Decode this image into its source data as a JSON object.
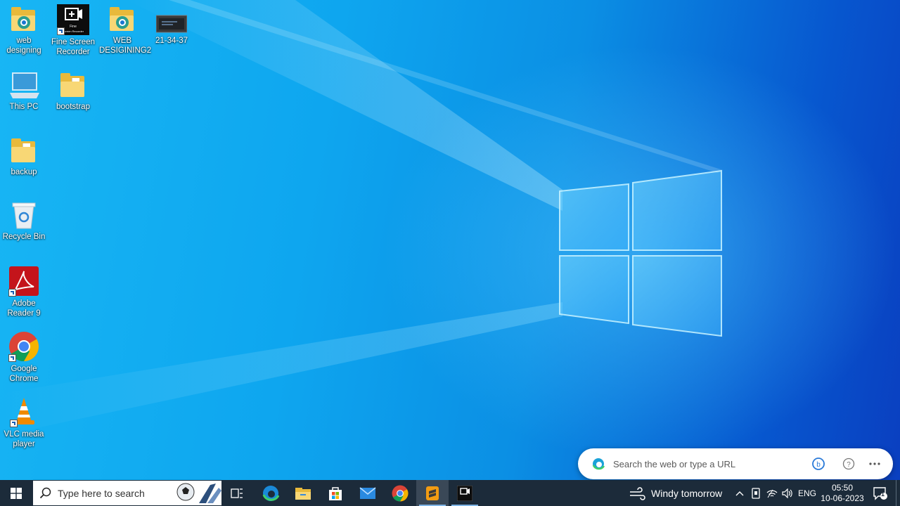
{
  "desktop": {
    "icons": [
      {
        "label_line1": "web",
        "label_line2": "designing",
        "icon": "web-folder-icon"
      },
      {
        "label_line1": "Fine Screen",
        "label_line2": "Recorder",
        "icon": "fine-screen-recorder-icon",
        "shortcut": true
      },
      {
        "label_line1": "WEB",
        "label_line2": "DESIGINING2",
        "icon": "web-folder-icon"
      },
      {
        "label_line1": "21-34-37",
        "label_line2": "",
        "icon": "video-file-icon"
      },
      {
        "label_line1": "This PC",
        "label_line2": "",
        "icon": "computer-icon"
      },
      {
        "label_line1": "bootstrap",
        "label_line2": "",
        "icon": "folder-icon"
      },
      {
        "label_line1": "backup",
        "label_line2": "",
        "icon": "folder-icon"
      },
      {
        "label_line1": "Recycle Bin",
        "label_line2": "",
        "icon": "recycle-bin-icon"
      },
      {
        "label_line1": "Adobe",
        "label_line2": "Reader 9",
        "icon": "adobe-reader-icon",
        "shortcut": true
      },
      {
        "label_line1": "Google",
        "label_line2": "Chrome",
        "icon": "chrome-icon",
        "shortcut": true
      },
      {
        "label_line1": "VLC media",
        "label_line2": "player",
        "icon": "vlc-icon",
        "shortcut": true
      }
    ],
    "recorder_icon_text": "Fine",
    "recorder_icon_subtext": "Screen Recorder"
  },
  "edge_search": {
    "placeholder": "Search the web or type a URL",
    "icons": [
      "edge-icon",
      "bing-chat-icon",
      "help-icon",
      "more-icon"
    ]
  },
  "taskbar": {
    "search_placeholder": "Type here to search",
    "apps": [
      "task-view-icon",
      "edge-icon",
      "file-explorer-icon",
      "microsoft-store-icon",
      "mail-icon",
      "chrome-icon",
      "sublime-text-icon",
      "fine-screen-recorder-icon"
    ],
    "weather": "Windy tomorrow",
    "language": "ENG",
    "time": "05:50",
    "date": "10-06-2023",
    "notification_count": "1"
  },
  "colors": {
    "taskbar": "#1c2b3a",
    "wallpaper_light": "#18b6f4",
    "wallpaper_dark": "#0a3fc0"
  }
}
